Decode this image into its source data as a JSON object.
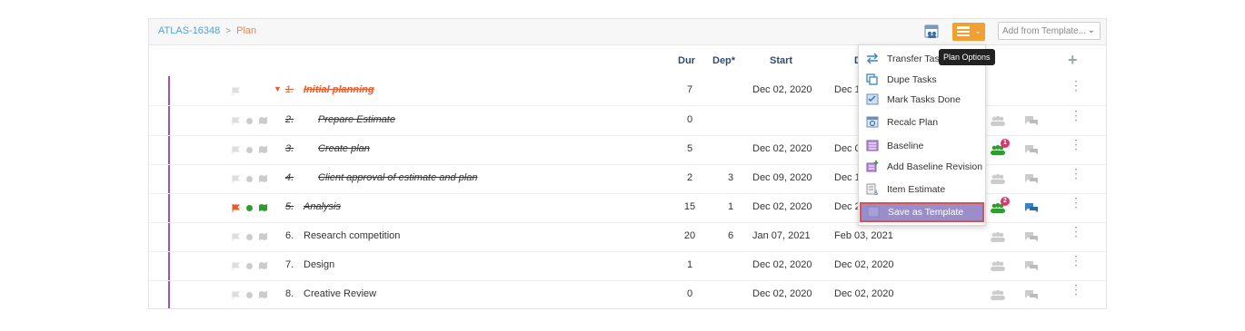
{
  "breadcrumb": {
    "project": "ATLAS-16348",
    "separator": ">",
    "current": "Plan"
  },
  "toolbar": {
    "template_placeholder": "Add from Template...",
    "tooltip": "Plan Options"
  },
  "columns": {
    "dur": "Dur",
    "dep": "Dep*",
    "start": "Start",
    "due": "D"
  },
  "colors": {
    "accent_orange": "#f0a033",
    "link_blue": "#5aa0c8",
    "purple_line": "#9d52b4",
    "green": "#2e9d2e",
    "red_flag": "#f05a28",
    "selected_menu": "#9b8dc9"
  },
  "rows": [
    {
      "num": "1.",
      "name": "Initial planning",
      "dur": "7",
      "dep": "",
      "start": "Dec 02, 2020",
      "due": "Dec 1"
    },
    {
      "num": "2.",
      "name": "Prepare Estimate",
      "dur": "0",
      "dep": "",
      "start": "",
      "due": ""
    },
    {
      "num": "3.",
      "name": "Create plan",
      "dur": "5",
      "dep": "",
      "start": "Dec 02, 2020",
      "due": "Dec 0",
      "badge": "1"
    },
    {
      "num": "4.",
      "name": "Client approval of estimate and plan",
      "dur": "2",
      "dep": "3",
      "start": "Dec 09, 2020",
      "due": "Dec 1"
    },
    {
      "num": "5.",
      "name": "Analysis",
      "dur": "15",
      "dep": "1",
      "start": "Dec 02, 2020",
      "due": "Dec 2",
      "badge": "2"
    },
    {
      "num": "6.",
      "name": "Research competition",
      "dur": "20",
      "dep": "6",
      "start": "Jan 07, 2021",
      "due": "Feb 03, 2021"
    },
    {
      "num": "7.",
      "name": "Design",
      "dur": "1",
      "dep": "",
      "start": "Dec 02, 2020",
      "due": "Dec 02, 2020"
    },
    {
      "num": "8.",
      "name": "Creative Review",
      "dur": "0",
      "dep": "",
      "start": "Dec 02, 2020",
      "due": "Dec 02, 2020"
    }
  ],
  "menu": [
    {
      "label": "Transfer Tasks",
      "icon": "transfer-icon"
    },
    {
      "label": "Dupe Tasks",
      "icon": "duplicate-icon"
    },
    {
      "label": "Mark Tasks Done",
      "icon": "check-list-icon"
    },
    {
      "label": "Recalc Plan",
      "icon": "calendar-recalc-icon"
    },
    {
      "label": "Baseline",
      "icon": "baseline-icon"
    },
    {
      "label": "Add Baseline Revision",
      "icon": "add-baseline-icon"
    },
    {
      "label": "Item Estimate",
      "icon": "estimate-icon"
    },
    {
      "label": "Save as Template",
      "icon": "template-icon"
    }
  ]
}
